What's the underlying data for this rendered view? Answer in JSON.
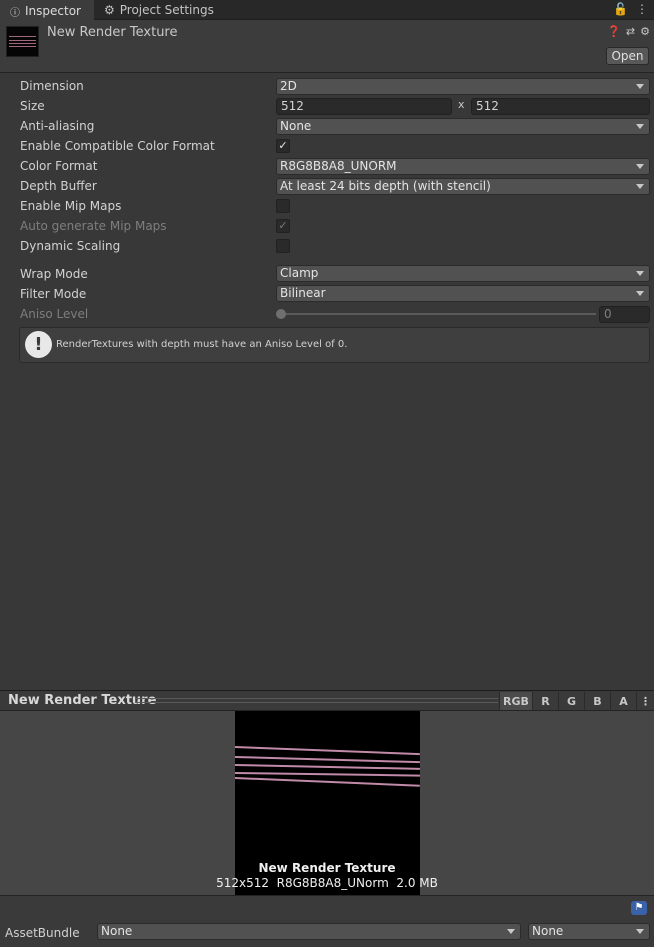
{
  "tabs": [
    {
      "label": "Inspector",
      "icon": "info-icon"
    },
    {
      "label": "Project Settings",
      "icon": "gear-icon"
    }
  ],
  "header": {
    "title": "New Render Texture",
    "open_label": "Open"
  },
  "properties": {
    "dimension": {
      "label": "Dimension",
      "value": "2D"
    },
    "size": {
      "label": "Size",
      "width": "512",
      "sep": "x",
      "height": "512"
    },
    "anti_aliasing": {
      "label": "Anti-aliasing",
      "value": "None"
    },
    "compatible_color": {
      "label": "Enable Compatible Color Format",
      "checked": true
    },
    "color_format": {
      "label": "Color Format",
      "value": "R8G8B8A8_UNORM"
    },
    "depth_buffer": {
      "label": "Depth Buffer",
      "value": "At least 24 bits depth (with stencil)"
    },
    "enable_mip_maps": {
      "label": "Enable Mip Maps",
      "checked": false
    },
    "auto_mip_maps": {
      "label": "Auto generate Mip Maps",
      "checked": true
    },
    "dynamic_scaling": {
      "label": "Dynamic Scaling",
      "checked": false
    },
    "wrap_mode": {
      "label": "Wrap Mode",
      "value": "Clamp"
    },
    "filter_mode": {
      "label": "Filter Mode",
      "value": "Bilinear"
    },
    "aniso_level": {
      "label": "Aniso Level",
      "value": "0"
    }
  },
  "help": {
    "text": "RenderTextures with depth must have an Aniso Level of 0."
  },
  "preview": {
    "title": "New Render Texture",
    "channels": [
      "RGB",
      "R",
      "G",
      "B",
      "A"
    ],
    "active_channel": "RGB",
    "caption_name": "New Render Texture",
    "caption_info": "512x512  R8G8B8A8_UNorm  2.0 MB"
  },
  "asset_bundle": {
    "label": "AssetBundle",
    "name_value": "None",
    "variant_value": "None"
  },
  "colors": {
    "background": "#383838",
    "line_color": "#c08aa8",
    "tag_blue": "#3b62a8"
  }
}
